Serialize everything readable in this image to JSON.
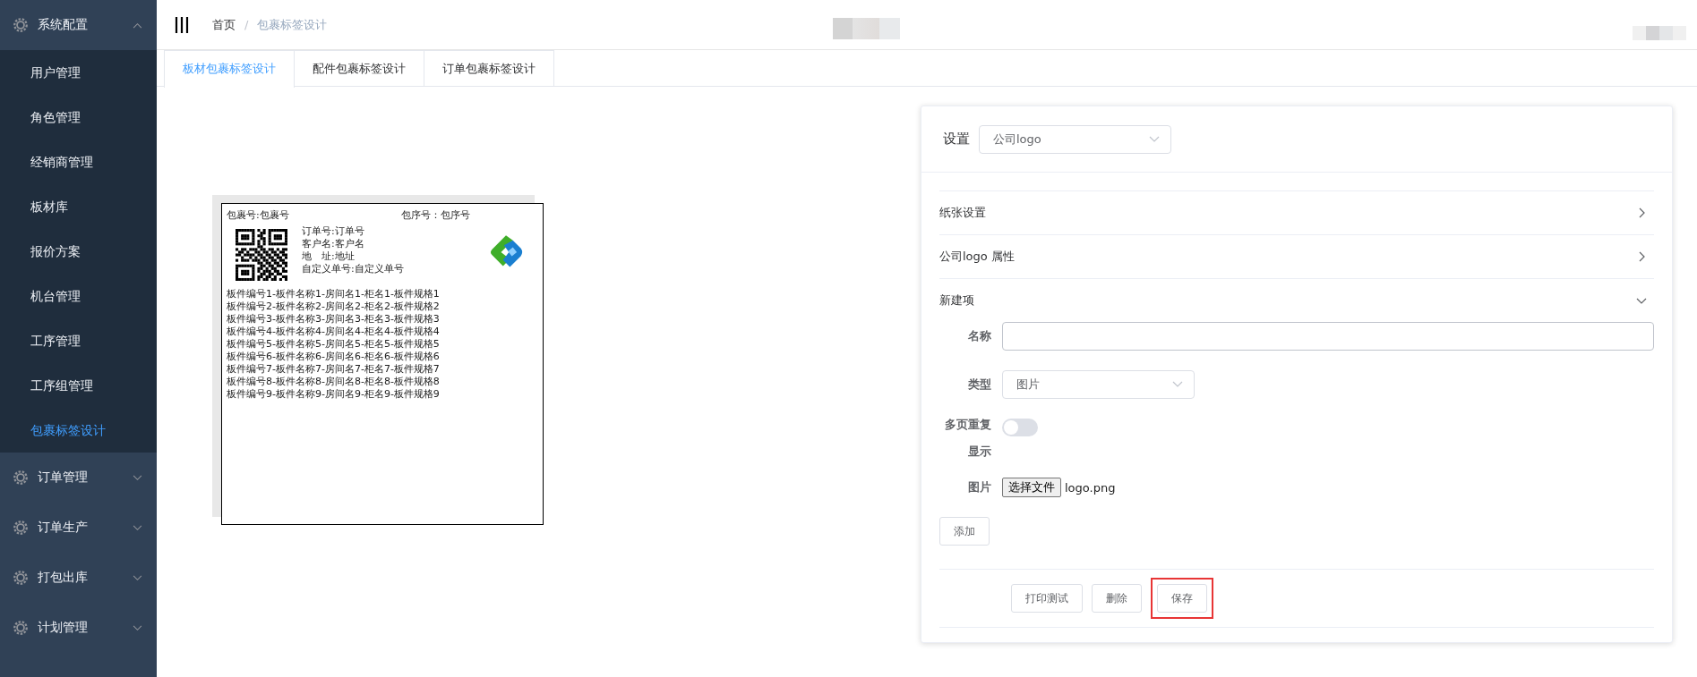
{
  "sidebar": {
    "groups": [
      {
        "label": "系统配置",
        "expanded": true,
        "children": [
          {
            "label": "用户管理",
            "selected": false
          },
          {
            "label": "角色管理",
            "selected": false
          },
          {
            "label": "经销商管理",
            "selected": false
          },
          {
            "label": "板材库",
            "selected": false
          },
          {
            "label": "报价方案",
            "selected": false
          },
          {
            "label": "机台管理",
            "selected": false
          },
          {
            "label": "工序管理",
            "selected": false
          },
          {
            "label": "工序组管理",
            "selected": false
          },
          {
            "label": "包裹标签设计",
            "selected": true
          }
        ]
      },
      {
        "label": "订单管理",
        "expanded": false
      },
      {
        "label": "订单生产",
        "expanded": false
      },
      {
        "label": "打包出库",
        "expanded": false
      },
      {
        "label": "计划管理",
        "expanded": false
      }
    ]
  },
  "breadcrumb": {
    "items": [
      "首页",
      "包裹标签设计"
    ],
    "separator": "/"
  },
  "tabs": [
    {
      "label": "板材包裹标签设计",
      "selected": true
    },
    {
      "label": "配件包裹标签设计",
      "selected": false
    },
    {
      "label": "订单包裹标签设计",
      "selected": false
    }
  ],
  "label_preview": {
    "package_no": "包裹号:包裹号",
    "sequence_no": "包序号：包序号",
    "info_lines": [
      "订单号:订单号",
      "客户名:客户名",
      "地　址:地址",
      "自定义单号:自定义单号"
    ],
    "item_lines": [
      "板件编号1-板件名称1-房间名1-柜名1-板件规格1",
      "板件编号2-板件名称2-房间名2-柜名2-板件规格2",
      "板件编号3-板件名称3-房间名3-柜名3-板件规格3",
      "板件编号4-板件名称4-房间名4-柜名4-板件规格4",
      "板件编号5-板件名称5-房间名5-柜名5-板件规格5",
      "板件编号6-板件名称6-房间名6-柜名6-板件规格6",
      "板件编号7-板件名称7-房间名7-柜名7-板件规格7",
      "板件编号8-板件名称8-房间名8-柜名8-板件规格8",
      "板件编号9-板件名称9-房间名9-柜名9-板件规格9"
    ]
  },
  "settings": {
    "label": "设置",
    "select_value": "公司logo",
    "sections": [
      {
        "title": "纸张设置",
        "expanded": false
      },
      {
        "title": "公司logo 属性",
        "expanded": false
      },
      {
        "title": "新建项",
        "expanded": true
      }
    ],
    "form": {
      "name_label": "名称",
      "type_label": "类型",
      "type_value": "图片",
      "repeat_label": "多页重复显示",
      "repeat_on": false,
      "image_label": "图片",
      "file_button": "选择文件",
      "file_name": "logo.png",
      "add_button": "添加"
    },
    "actions": [
      {
        "label": "打印测试",
        "highlighted": false
      },
      {
        "label": "删除",
        "highlighted": false
      },
      {
        "label": "保存",
        "highlighted": true
      }
    ]
  }
}
